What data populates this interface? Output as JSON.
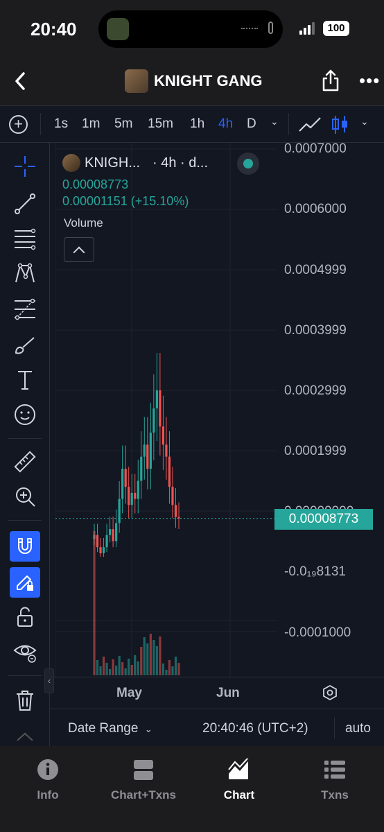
{
  "status_bar": {
    "time": "20:40",
    "battery": "100"
  },
  "header": {
    "title": "KNIGHT GANG"
  },
  "toolbar": {
    "intervals": [
      "1s",
      "1m",
      "5m",
      "15m",
      "1h",
      "4h",
      "D"
    ],
    "active_interval": "4h"
  },
  "legend": {
    "symbol": "KNIGH...",
    "interval_text": "· 4h · d...",
    "price": "0.00008773",
    "change": "0.00001151 (+15.10%)",
    "volume_label": "Volume"
  },
  "price_axis": {
    "labels": [
      "0.0007000",
      "0.0006000",
      "0.0004999",
      "0.0003999",
      "0.0002999",
      "0.0001999",
      "0.00009999",
      "0.00008773",
      "-0.0₁₉8131",
      "-0.0001000"
    ],
    "last_price": "0.00008773"
  },
  "time_axis": {
    "labels": [
      "May",
      "Jun"
    ]
  },
  "range_bar": {
    "date_range": "Date Range",
    "clock": "20:40:46 (UTC+2)",
    "auto": "auto"
  },
  "tabs": [
    {
      "label": "Info",
      "icon": "info-icon"
    },
    {
      "label": "Chart+Txns",
      "icon": "chart-txns-icon"
    },
    {
      "label": "Chart",
      "icon": "chart-icon"
    },
    {
      "label": "Txns",
      "icon": "txns-icon"
    }
  ],
  "active_tab": "Chart",
  "colors": {
    "up": "#26a69a",
    "down": "#ef5350",
    "accent": "#2962ff",
    "background": "#131722"
  },
  "chart_data": {
    "type": "candlestick",
    "y_axis_ticks": [
      0.0007,
      0.0006,
      0.0004999,
      0.0003999,
      0.0002999,
      0.0001999,
      9.999e-05,
      -8.131e-05,
      -0.0001
    ],
    "ylim": [
      -0.000165,
      0.0007
    ],
    "x_axis_ticks": [
      "May",
      "Jun"
    ],
    "last_price": 8.773e-05,
    "change": 1.151e-05,
    "change_pct": 15.1,
    "approx_close_series": [
      6e-05,
      4e-05,
      3e-05,
      4e-05,
      6e-05,
      7e-05,
      5e-05,
      8e-05,
      0.00012,
      0.00017,
      0.00014,
      0.00011,
      0.00013,
      0.00012,
      0.00015,
      0.00019,
      0.00021,
      0.00017,
      0.00023,
      0.00027,
      0.0003,
      0.00024,
      0.00021,
      0.00019,
      0.00014,
      0.00011,
      9e-05,
      8.773e-05
    ]
  }
}
